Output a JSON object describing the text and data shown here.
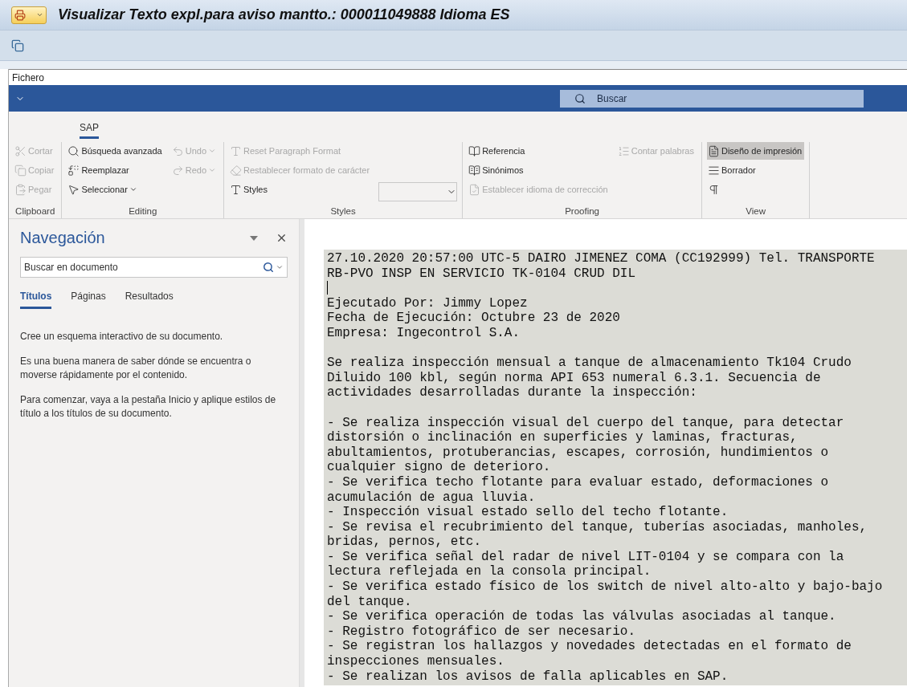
{
  "window": {
    "title": "Visualizar Texto expl.para aviso mantto.: 000011049888 Idioma ES"
  },
  "menu": {
    "label": "Fichero"
  },
  "search_bar": {
    "placeholder": "Buscar"
  },
  "ribbon": {
    "tab": {
      "label": "SAP",
      "selected": true
    },
    "groups": [
      {
        "label": "Clipboard",
        "columns": [
          [
            {
              "label": "Cortar",
              "disabled": true
            },
            {
              "label": "Copiar",
              "disabled": true
            },
            {
              "label": "Pegar",
              "disabled": true
            }
          ]
        ]
      },
      {
        "label": "Editing",
        "columns": [
          [
            {
              "label": "Búsqueda avanzada",
              "disabled": false
            },
            {
              "label": "Reemplazar",
              "disabled": false
            },
            {
              "label": "Seleccionar",
              "disabled": false,
              "dropdown": true
            }
          ],
          [
            {
              "label": "Undo",
              "disabled": true,
              "dropdown": true
            },
            {
              "label": "Redo",
              "disabled": true,
              "dropdown": true
            }
          ]
        ]
      },
      {
        "label": "Styles",
        "columns": [
          [
            {
              "label": "Reset Paragraph Format",
              "disabled": true
            },
            {
              "label": "Restablecer formato de carácter",
              "disabled": true
            },
            {
              "label": "Styles",
              "disabled": false
            }
          ],
          [
            {
              "kind": "combo"
            }
          ]
        ]
      },
      {
        "label": "Proofing",
        "columns": [
          [
            {
              "label": "Referencia",
              "disabled": false
            },
            {
              "label": "Sinónimos",
              "disabled": false
            },
            {
              "label": "Establecer idioma de corrección",
              "disabled": true
            }
          ],
          [
            {
              "label": "Contar palabras",
              "disabled": true
            }
          ]
        ]
      },
      {
        "label": "View",
        "columns": [
          [
            {
              "label": "Diseño de impresión",
              "disabled": false,
              "selected": true
            },
            {
              "label": "Borrador",
              "disabled": false,
              "selected": false
            },
            {
              "disabled": false,
              "selected": false
            }
          ]
        ]
      }
    ]
  },
  "navigation": {
    "title": "Navegación",
    "search": {
      "placeholder": "Buscar en documento"
    },
    "tabs": [
      {
        "label": "Títulos",
        "selected": true
      },
      {
        "label": "Páginas",
        "selected": false
      },
      {
        "label": "Resultados",
        "selected": false
      }
    ],
    "paragraphs": [
      "Cree un esquema interactivo de su documento.",
      "Es una buena manera de saber dónde se encuentra o moverse rápidamente por el contenido.",
      "Para comenzar, vaya a la pestaña Inicio y aplique estilos de título a los títulos de su documento."
    ]
  },
  "document": {
    "paragraphs": [
      {
        "lines": [
          "27.10.2020 20:57:00 UTC-5 DAIRO JIMENEZ COMA (CC192999) Tel. TRANSPORTE",
          "RB-PVO INSP EN SERVICIO TK-0104 CRUD DIL"
        ],
        "cursor_after": true
      },
      {
        "lines": [
          "Ejecutado Por: Jimmy Lopez",
          "Fecha de Ejecución: Octubre 23 de 2020",
          "Empresa: Ingecontrol S.A."
        ]
      },
      {
        "lines": [
          "Se realiza inspección mensual a tanque de almacenamiento Tk104 Crudo",
          "Diluido 100 kbl, según norma API 653 numeral 6.3.1. Secuencia de",
          "actividades desarrolladas durante la inspección:"
        ]
      },
      {
        "lines": [
          "- Se realiza inspección visual del cuerpo del tanque, para detectar",
          "distorsión o inclinación en superficies y laminas, fracturas,",
          "abultamientos, protuberancias, escapes, corrosión, hundimientos o",
          "cualquier signo de deterioro.",
          "- Se verifica techo flotante para evaluar estado, deformaciones o",
          "acumulación de agua lluvia.",
          "- Inspección visual estado sello del techo flotante.",
          "- Se revisa el recubrimiento del tanque, tuberías asociadas, manholes,",
          "bridas, pernos, etc.",
          "- Se verifica señal del radar de nivel LIT-0104 y se compara con la",
          "lectura reflejada en la consola principal.",
          "- Se verifica estado físico de los switch de nivel alto-alto y bajo-bajo",
          "del tanque.",
          "- Se verifica operación de todas las válvulas asociadas al tanque.",
          "- Registro fotográfico de ser necesario.",
          "- Se registran los hallazgos y novedades detectadas en el formato de",
          "inspecciones mensuales.",
          "- Se realizan los avisos de falla aplicables en SAP."
        ]
      }
    ]
  }
}
